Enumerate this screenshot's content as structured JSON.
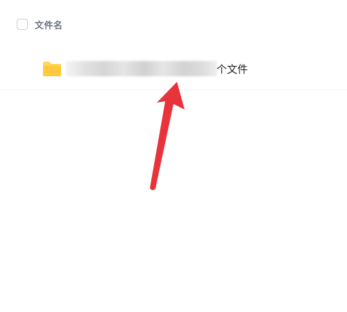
{
  "file_list": {
    "header": {
      "name_column_label": "文件名",
      "select_all_checked": false
    },
    "rows": [
      {
        "name_suffix": "个文件",
        "type": "folder",
        "icon": "folder-icon",
        "icon_color": "#FFD65B"
      }
    ]
  },
  "annotation": {
    "icon": "red-arrow-pointer",
    "color": "#E8333A"
  }
}
